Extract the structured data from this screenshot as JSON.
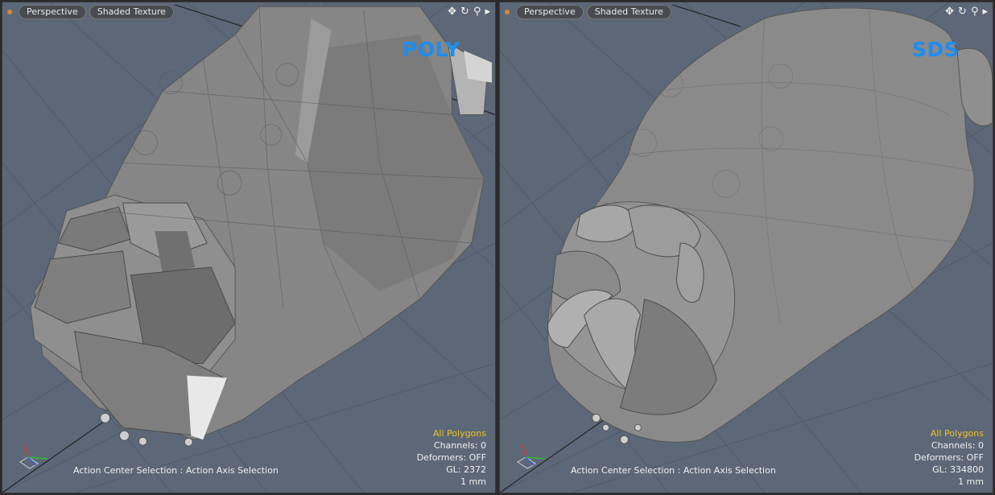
{
  "viewports": [
    {
      "view_label": "Perspective",
      "shading_label": "Shaded Texture",
      "mode_label": "POLY",
      "status": "Action Center Selection : Action Axis Selection",
      "selection": "All Polygons",
      "channels": "Channels: 0",
      "deformers": "Deformers: OFF",
      "gl": "GL: 2372",
      "units": "1 mm"
    },
    {
      "view_label": "Perspective",
      "shading_label": "Shaded Texture",
      "mode_label": "SDS",
      "status": "Action Center Selection : Action Axis Selection",
      "selection": "All Polygons",
      "channels": "Channels: 0",
      "deformers": "Deformers: OFF",
      "gl": "GL: 334800",
      "units": "1 mm"
    }
  ],
  "icons": [
    "move-view-icon",
    "rotate-view-icon",
    "zoom-view-icon",
    "viewport-menu-arrow-icon"
  ],
  "colors": {
    "background": "#5c6878",
    "mode_label": "#1b8ef2",
    "selection_text": "#f0c020"
  }
}
